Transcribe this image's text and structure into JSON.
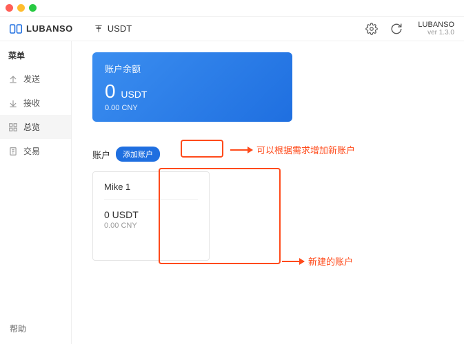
{
  "header": {
    "brand": "LUBANSO",
    "currency": "USDT",
    "app_name": "LUBANSO",
    "version": "ver 1.3.0"
  },
  "sidebar": {
    "title": "菜单",
    "items": [
      {
        "label": "发送"
      },
      {
        "label": "接收"
      },
      {
        "label": "总览"
      },
      {
        "label": "交易"
      }
    ],
    "help": "帮助"
  },
  "balance": {
    "title": "账户余额",
    "amount": "0",
    "unit": "USDT",
    "sub": "0.00 CNY"
  },
  "accounts": {
    "label": "账户",
    "add_btn": "添加账户",
    "card": {
      "name": "Mike 1",
      "balance": "0 USDT",
      "sub": "0.00 CNY"
    }
  },
  "annotations": {
    "add": "可以根据需求增加新账户",
    "new": "新建的账户"
  }
}
